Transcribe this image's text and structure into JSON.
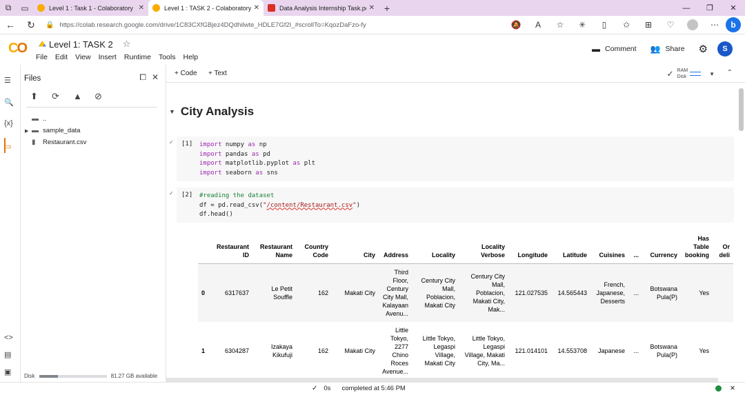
{
  "browser": {
    "tabs": [
      {
        "title": "Level 1 : Task 1 - Colaboratory",
        "active": false,
        "favicon": "colab"
      },
      {
        "title": "Level 1 : TASK 2 - Colaboratory",
        "active": true,
        "favicon": "colab"
      },
      {
        "title": "Data Analysis Internship Task.pdf",
        "active": false,
        "favicon": "pdf"
      }
    ],
    "url": "https://colab.research.google.com/drive/1C83CXfGBjez4DQdhilwte_HDLE7Gf2I_#scrollTo=KqozDaFzo-fy"
  },
  "colab": {
    "notebook_title": "Level 1: TASK 2",
    "menu": [
      "File",
      "Edit",
      "View",
      "Insert",
      "Runtime",
      "Tools",
      "Help"
    ],
    "comment_label": "Comment",
    "share_label": "Share",
    "avatar_letter": "S",
    "add_code": "+ Code",
    "add_text": "+ Text",
    "ram_label": "RAM",
    "disk_label": "Disk"
  },
  "files": {
    "title": "Files",
    "tree": [
      {
        "name": "..",
        "type": "parent"
      },
      {
        "name": "sample_data",
        "type": "folder"
      },
      {
        "name": "Restaurant.csv",
        "type": "file"
      }
    ],
    "disk_label": "Disk",
    "disk_free": "81.27 GB available",
    "disk_used_fraction": 0.28
  },
  "notebook": {
    "section_title": "City Analysis",
    "cell1": {
      "count": "[1]"
    },
    "cell2": {
      "count": "[2]"
    }
  },
  "output_table": {
    "headers": [
      "",
      "Restaurant ID",
      "Restaurant Name",
      "Country Code",
      "City",
      "Address",
      "Locality",
      "Locality Verbose",
      "Longitude",
      "Latitude",
      "Cuisines",
      "...",
      "Currency",
      "Has Table booking",
      "Or deli"
    ],
    "rows": [
      [
        "0",
        "6317637",
        "Le Petit Souffle",
        "162",
        "Makati City",
        "Third Floor, Century City Mall, Kalayaan Avenu...",
        "Century City Mall, Poblacion, Makati City",
        "Century City Mall, Poblacion, Makati City, Mak...",
        "121.027535",
        "14.565443",
        "French, Japanese, Desserts",
        "...",
        "Botswana Pula(P)",
        "Yes",
        ""
      ],
      [
        "1",
        "6304287",
        "Izakaya Kikufuji",
        "162",
        "Makati City",
        "Little Tokyo, 2277 Chino Roces Avenue...",
        "Little Tokyo, Legaspi Village, Makati City",
        "Little Tokyo, Legaspi Village, Makati City, Ma...",
        "121.014101",
        "14.553708",
        "Japanese",
        "...",
        "Botswana Pula(P)",
        "Yes",
        ""
      ]
    ]
  },
  "status": {
    "duration": "0s",
    "completed": "completed at 5:46 PM"
  },
  "colors": {
    "tab_strip": "#e9d6ee",
    "colab_orange": "#f9ab00",
    "keyword": "#9c27b0",
    "comment": "#188038",
    "string": "#a31515",
    "connected": "#1e8e3e"
  }
}
